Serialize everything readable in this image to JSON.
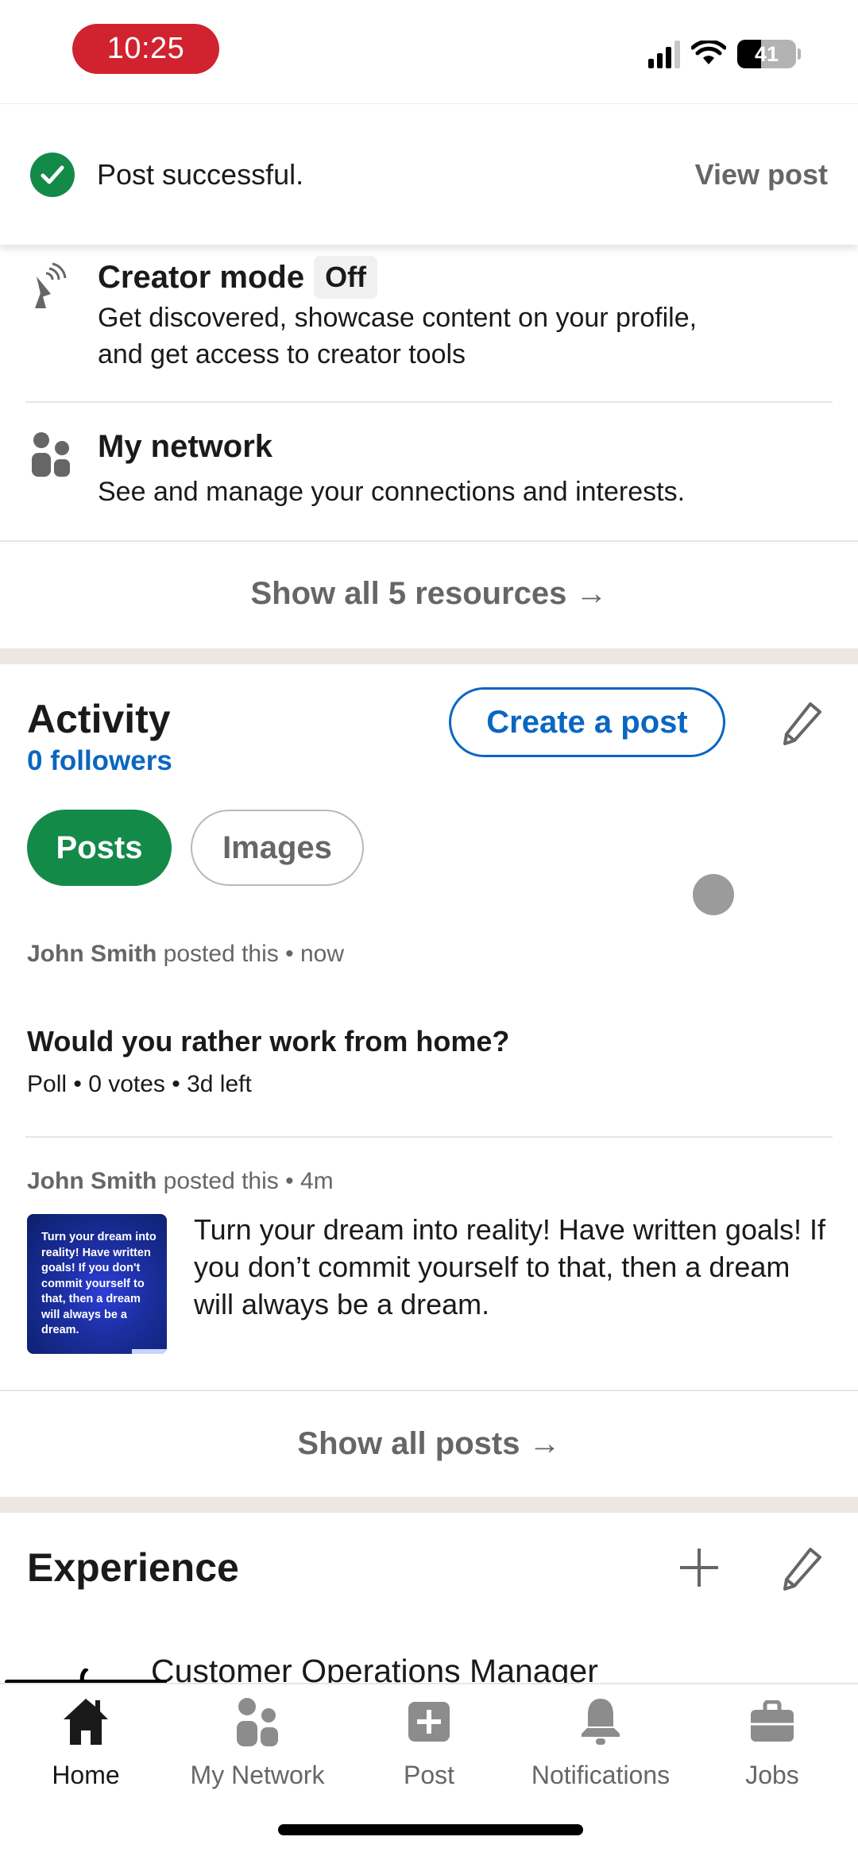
{
  "status_bar": {
    "time": "10:25",
    "battery_level": "41",
    "battery_fraction": 0.41,
    "signal_bars_active": 3,
    "signal_bars_total": 4
  },
  "toast": {
    "icon": "check-circle-icon",
    "message": "Post successful.",
    "action": "View post",
    "color": "#138a48"
  },
  "resources": {
    "items": [
      {
        "icon": "satellite-dish-icon",
        "title": "Creator mode",
        "badge": "Off",
        "description_lines": [
          "Get discovered, showcase content on your profile,",
          "and get access to creator tools"
        ]
      },
      {
        "icon": "people-icon",
        "title": "My network",
        "description_lines": [
          "See and manage your connections and interests."
        ]
      }
    ],
    "show_all": "Show all 5 resources →"
  },
  "activity": {
    "title": "Activity",
    "followers": "0 followers",
    "create_post": "Create a post",
    "edit_icon": "pencil-icon",
    "filters": [
      {
        "label": "Posts",
        "active": true
      },
      {
        "label": "Images",
        "active": false
      }
    ],
    "posts": [
      {
        "author": "John Smith",
        "action": " posted this • now",
        "title": "Would you rather work from home?",
        "subtitle": "Poll • 0 votes • 3d left"
      },
      {
        "author": "John Smith",
        "action": " posted this • 4m",
        "thumbnail_text": "Turn your dream into reality! Have written goals! If you don't commit yourself to that, then a dream will always be a dream.",
        "text": "Turn your dream into reality! Have written goals! If you don’t commit yourself to that, then a dream will always be a dream."
      }
    ],
    "show_all": "Show all posts →"
  },
  "experience": {
    "title": "Experience",
    "add_icon": "plus-icon",
    "edit_icon": "pencil-icon",
    "first_job_title": "Customer Operations Manager"
  },
  "bottom_nav": {
    "items": [
      {
        "label": "Home",
        "icon": "home-icon",
        "active": true
      },
      {
        "label": "My Network",
        "icon": "people-icon",
        "active": false
      },
      {
        "label": "Post",
        "icon": "plus-square-icon",
        "active": false
      },
      {
        "label": "Notifications",
        "icon": "bell-icon",
        "active": false
      },
      {
        "label": "Jobs",
        "icon": "briefcase-icon",
        "active": false
      }
    ]
  },
  "colors": {
    "brand_blue": "#0a66c2",
    "success_green": "#138a48",
    "time_pill_red": "#d0232f"
  }
}
